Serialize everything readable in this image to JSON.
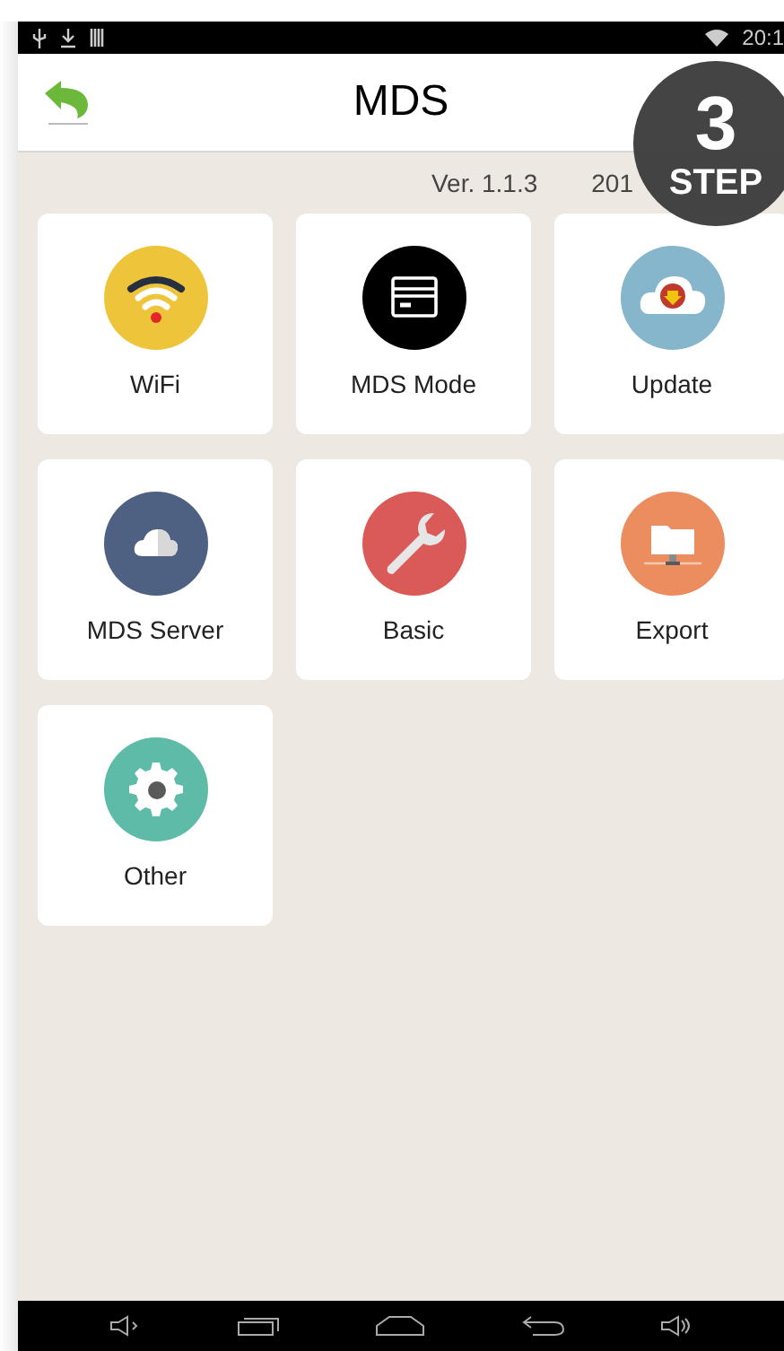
{
  "status_bar": {
    "time": "20:1"
  },
  "header": {
    "title": "MDS"
  },
  "info": {
    "version": "Ver. 1.1.3",
    "date_start": "201"
  },
  "step_badge": {
    "number": "3",
    "label": "STEP"
  },
  "tiles": [
    {
      "label": "WiFi",
      "kind": "wifi",
      "color": "#eec53a"
    },
    {
      "label": "MDS Mode",
      "kind": "mode",
      "color": "#000000"
    },
    {
      "label": "Update",
      "kind": "update",
      "color": "#86b6cb"
    },
    {
      "label": "MDS Server",
      "kind": "server",
      "color": "#4e6182"
    },
    {
      "label": "Basic",
      "kind": "basic",
      "color": "#d95a56"
    },
    {
      "label": "Export",
      "kind": "export",
      "color": "#eb8d5f"
    },
    {
      "label": "Other",
      "kind": "other",
      "color": "#5dbba8"
    }
  ]
}
